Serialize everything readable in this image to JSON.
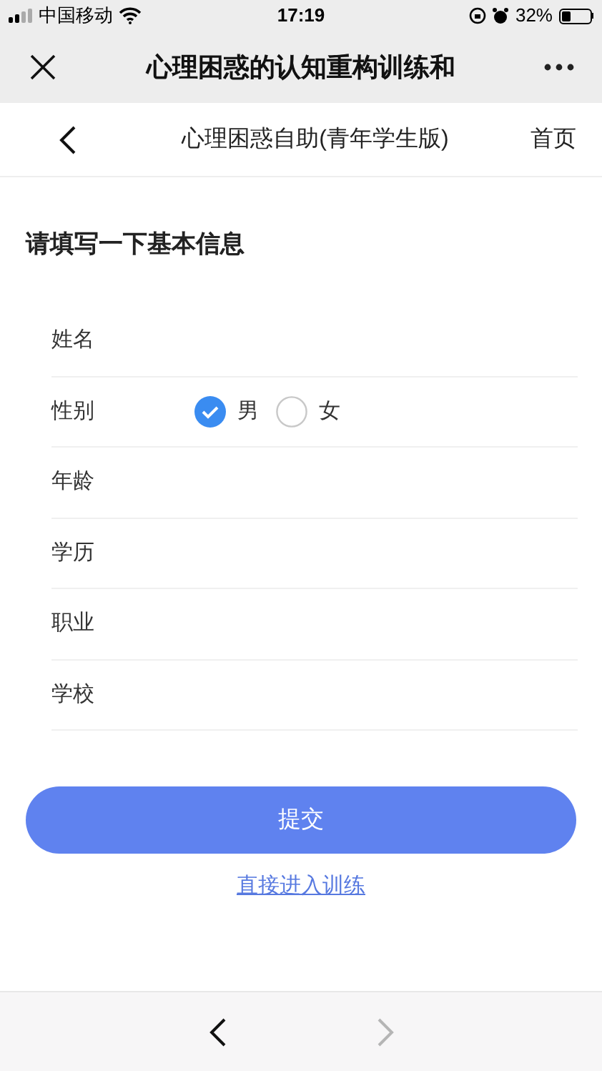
{
  "status_bar": {
    "carrier": "中国移动",
    "time": "17:19",
    "battery": "32%"
  },
  "title_bar": {
    "title": "心理困惑的认知重构训练和"
  },
  "nav_bar": {
    "title": "心理困惑自助(青年学生版)",
    "home": "首页"
  },
  "form": {
    "heading": "请填写一下基本信息",
    "fields": [
      {
        "kind": "text",
        "label": "姓名"
      },
      {
        "kind": "radio",
        "label": "性别",
        "options": [
          {
            "label": "男",
            "selected": true
          },
          {
            "label": "女",
            "selected": false
          }
        ]
      },
      {
        "kind": "text",
        "label": "年龄"
      },
      {
        "kind": "text",
        "label": "学历"
      },
      {
        "kind": "text",
        "label": "职业"
      },
      {
        "kind": "text",
        "label": "学校"
      }
    ]
  },
  "submit_button": "提交",
  "skip_link": "直接进入训练",
  "toolbar": {
    "back_disabled": false,
    "forward_disabled": true
  }
}
